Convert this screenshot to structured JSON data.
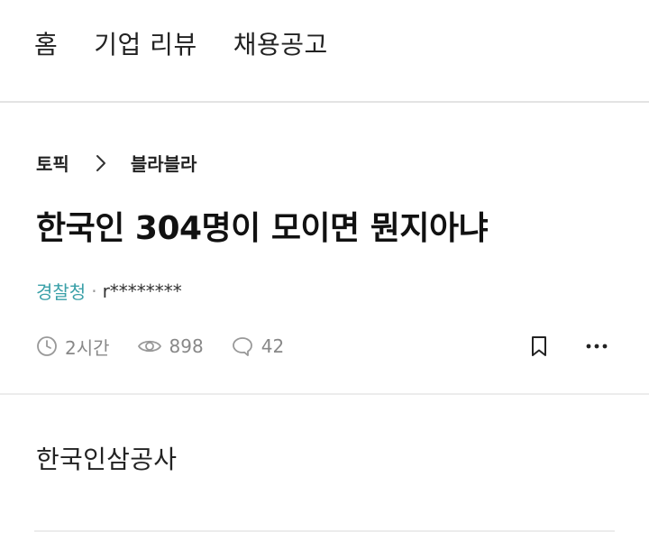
{
  "nav": {
    "items": [
      {
        "label": "홈"
      },
      {
        "label": "기업 리뷰"
      },
      {
        "label": "채용공고"
      }
    ]
  },
  "breadcrumb": {
    "topic": "토픽",
    "category": "블라블라"
  },
  "post": {
    "title": "한국인 304명이 모이면 뭔지아냐",
    "author_company": "경찰청",
    "author_separator": "·",
    "author_nick": "r********",
    "time": "2시간",
    "views": "898",
    "comments": "42",
    "body": "한국인삼공사"
  },
  "icons": {
    "clock": "clock-icon",
    "eye": "eye-icon",
    "comment": "comment-icon",
    "bookmark": "bookmark-icon",
    "more": "more-icon",
    "chevron": "chevron-right-icon"
  },
  "colors": {
    "company_accent": "#3aa0a8",
    "muted": "#888888"
  }
}
